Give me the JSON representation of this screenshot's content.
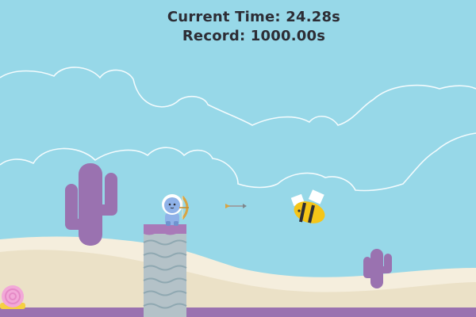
{
  "hud": {
    "current_time_label": "Current Time: 24.28s",
    "record_label": "Record: 1000.00s"
  },
  "colors": {
    "sky": "#97d8e8",
    "cloud_outline": "#f3fbfd",
    "sand_back": "#f5eedd",
    "sand_front": "#ebe1c7",
    "cactus": "#9a72b0",
    "ground_strip": "#9a72b0",
    "pillar_top": "#a979b8",
    "pillar_body": "#b4c2c8",
    "pillar_wave": "#8fa8b1",
    "astronaut_helmet": "#ffffff",
    "astronaut_body": "#8fb2e8",
    "bow": "#d9a441",
    "bee_body": "#f5c518",
    "bee_stripe": "#2d2d35",
    "bee_wing": "#ffffff",
    "snail_shell": "#f2a8d8",
    "snail_body": "#f5d041"
  },
  "icons": {
    "player": "astronaut-archer-icon",
    "enemy": "bee-icon",
    "projectile": "arrow-icon",
    "snail": "snail-icon"
  }
}
